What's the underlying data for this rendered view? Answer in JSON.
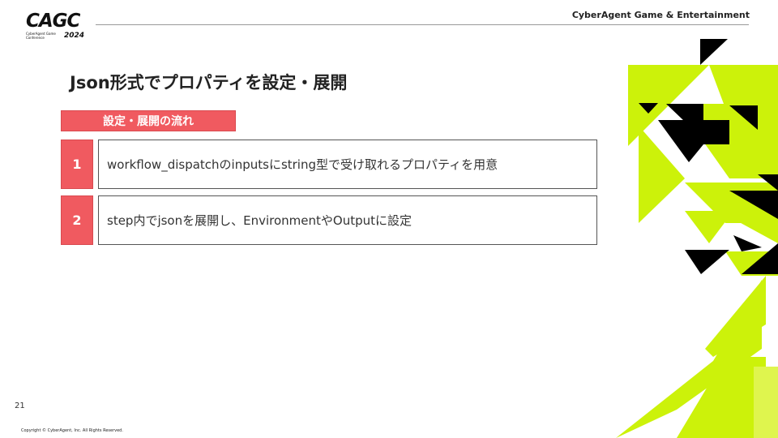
{
  "header": {
    "logo_text": "CAGC",
    "logo_subtext": "CyberAgent Game Conference",
    "logo_year": "2024",
    "company": "CyberAgent Game & Entertainment"
  },
  "slide": {
    "title": "Json形式でプロパティを設定・展開",
    "section_label": "設定・展開の流れ",
    "steps": [
      {
        "number": "1",
        "text": "workflow_dispatchのinputsにstring型で受け取れるプロパティを用意"
      },
      {
        "number": "2",
        "text": "step内でjsonを展開し、EnvironmentやOutputに設定"
      }
    ]
  },
  "footer": {
    "page_number": "21",
    "copyright": "Copyright © CyberAgent, Inc. All Rights Reserved."
  },
  "colors": {
    "accent": "#f05a60",
    "lime": "#ccf20a",
    "black": "#000000"
  }
}
